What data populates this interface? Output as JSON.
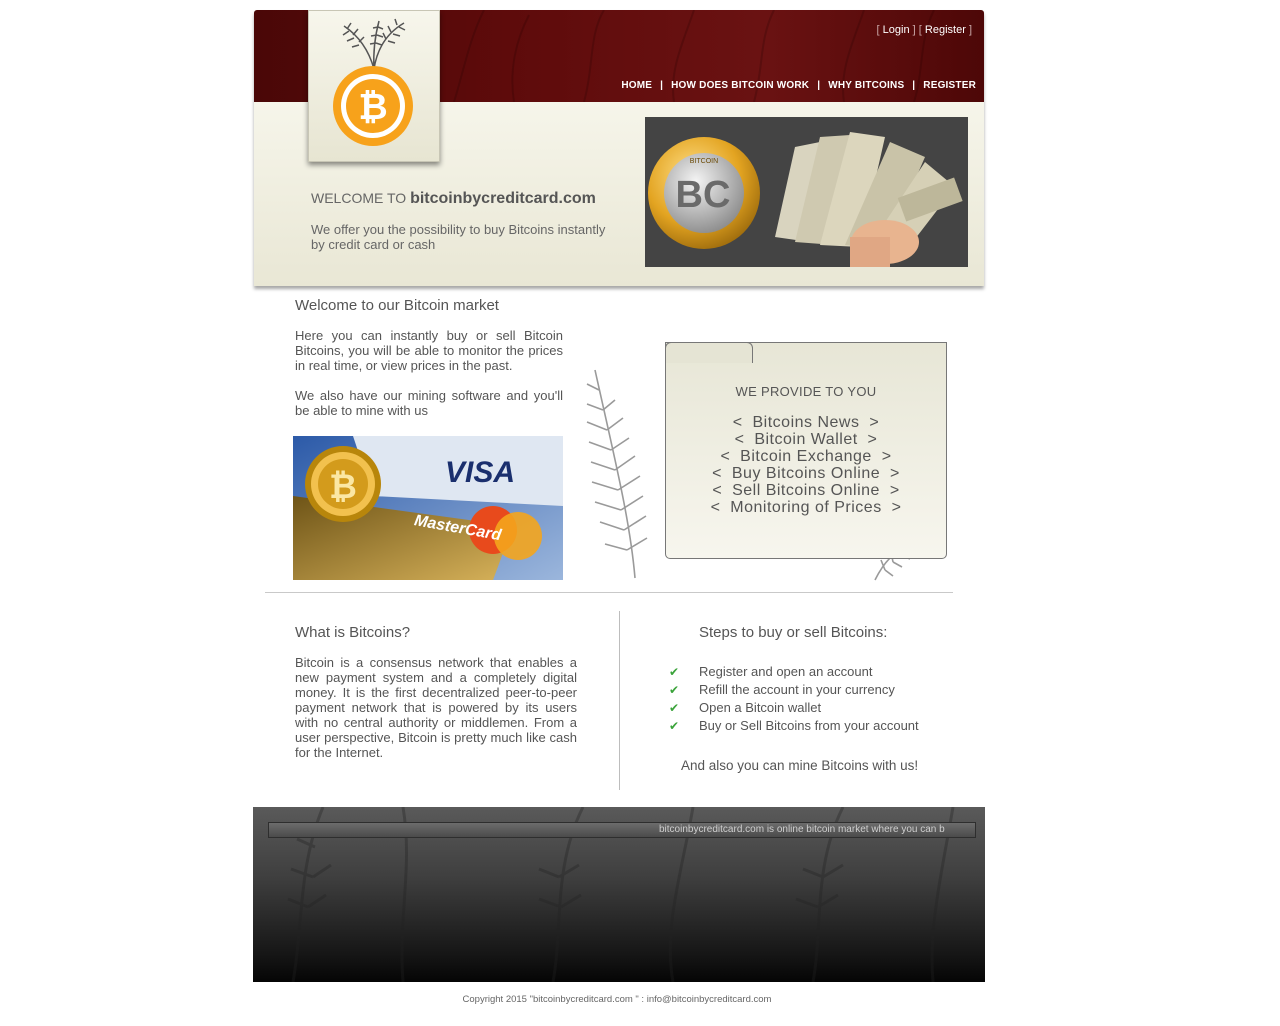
{
  "header": {
    "auth": {
      "login_label": "Login",
      "register_label": "Register",
      "open_bracket": "[",
      "close_bracket": "]"
    },
    "nav": [
      {
        "label": "HOME"
      },
      {
        "label": "HOW DOES BITCOIN WORK"
      },
      {
        "label": "WHY BITCOINS"
      },
      {
        "label": "REGISTER"
      }
    ],
    "nav_separator": "|",
    "welcome_prefix": "WELCOME TO",
    "welcome_site": "bitcoinbycreditcard.com",
    "welcome_text": "We offer you the possibility to buy Bitcoins instantly by credit card or cash",
    "hero_coin_letters": "BC",
    "hero_coin_text": "BITCOIN"
  },
  "market": {
    "title": "Welcome to our Bitcoin market",
    "paragraph1": "Here you can instantly buy or sell Bitcoin Bitcoins, you will be able to monitor the prices in real time, or view prices in the past.",
    "paragraph2": "We also have our mining software and you'll be able to mine with us",
    "card_visa": "VISA",
    "card_mastercard": "MasterCard"
  },
  "provide": {
    "title": "WE PROVIDE TO YOU",
    "items": [
      "<  Bitcoins News  >",
      "<  Bitcoin Wallet  >",
      "<  Bitcoin Exchange  >",
      "<  Buy Bitcoins Online  >",
      "<  Sell Bitcoins Online  >",
      "<  Monitoring of Prices  >"
    ]
  },
  "what": {
    "title": "What is Bitcoins?",
    "text": "Bitcoin is a consensus network that enables a new payment system and a completely digital money. It is the first decentralized peer-to-peer payment network that is powered by its users with no central authority or middlemen. From a user perspective, Bitcoin is pretty much like cash for the Internet."
  },
  "steps": {
    "title": "Steps to buy or sell Bitcoins:",
    "check_glyph": "✔",
    "items": [
      "Register and open an account",
      "Refill the account in your currency",
      "Open a Bitcoin wallet",
      "Buy or Sell Bitcoins from your account"
    ],
    "mine_text": "And also you can mine Bitcoins with us!"
  },
  "footer": {
    "ticker_text": "bitcoinbycreditcard.com is online bitcoin market where you can b",
    "copyright_prefix": "Copyright 2015 \"bitcoinbycreditcard.com \" :",
    "email": "info@bitcoinbycreditcard.com"
  },
  "colors": {
    "header_red": "#5e0b0b",
    "bitcoin_orange": "#f7a21b",
    "check_green": "#3aa33a",
    "footer_dark": "#151515"
  }
}
